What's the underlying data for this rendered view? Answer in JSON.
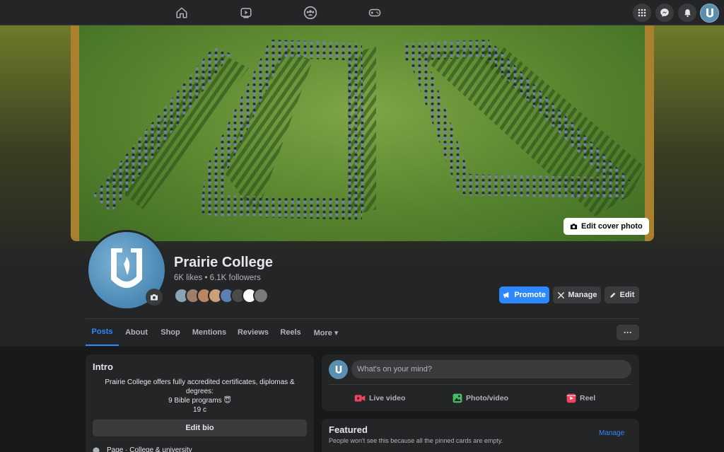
{
  "colors": {
    "accent": "#2d88ff",
    "background": "#18191a",
    "card": "#242526",
    "live_video": "#f3425f",
    "photo_video": "#45bd62"
  },
  "topnav": {
    "icons": [
      "home-icon",
      "watch-icon",
      "groups-icon",
      "gaming-icon"
    ],
    "right_icons": [
      "menu-grid-icon",
      "messenger-icon",
      "notifications-icon",
      "account-avatar"
    ]
  },
  "cover": {
    "edit_cover_label": "Edit cover photo"
  },
  "page": {
    "name": "Prairie College",
    "stats": "6K likes • 6.1K followers"
  },
  "actions": {
    "promote": "Promote",
    "manage": "Manage",
    "edit": "Edit"
  },
  "tabs": [
    {
      "label": "Posts",
      "active": true
    },
    {
      "label": "About"
    },
    {
      "label": "Shop"
    },
    {
      "label": "Mentions"
    },
    {
      "label": "Reviews"
    },
    {
      "label": "Reels"
    },
    {
      "label": "More ▾"
    }
  ],
  "more_label": "···",
  "intro": {
    "title": "Intro",
    "line1": "Prairie College offers fully accredited certificates, diplomas &",
    "line2": "degrees:",
    "line3": "9 Bible programs 😇",
    "line4": "19 c",
    "edit_bio": "Edit bio",
    "category": "Page · College & university"
  },
  "composer": {
    "placeholder": "What's on your mind?",
    "live_video": "Live video",
    "photo_video": "Photo/video",
    "reel": "Reel"
  },
  "featured": {
    "title": "Featured",
    "subtitle": "People won't see this because all the pinned cards are empty.",
    "manage": "Manage"
  }
}
